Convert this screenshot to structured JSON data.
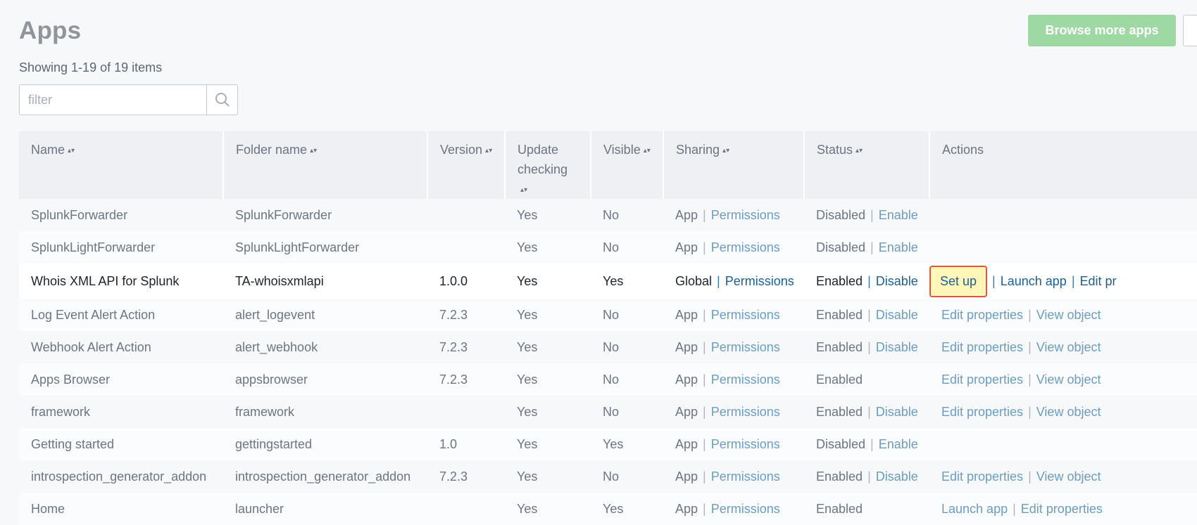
{
  "page": {
    "title": "Apps",
    "browse_more_label": "Browse more apps",
    "showing_text": "Showing 1-19 of 19 items"
  },
  "filter": {
    "placeholder": "filter",
    "value": ""
  },
  "table": {
    "columns": [
      "Name",
      "Folder name",
      "Version",
      "Update checking",
      "Visible",
      "Sharing",
      "Status",
      "Actions"
    ],
    "rows": [
      {
        "name": "SplunkForwarder",
        "folder": "SplunkForwarder",
        "version": "",
        "update": "Yes",
        "visible": "No",
        "sharing": "App",
        "sharing_link": "Permissions",
        "status": "Disabled",
        "status_link": "Enable",
        "actions": []
      },
      {
        "name": "SplunkLightForwarder",
        "folder": "SplunkLightForwarder",
        "version": "",
        "update": "Yes",
        "visible": "No",
        "sharing": "App",
        "sharing_link": "Permissions",
        "status": "Disabled",
        "status_link": "Enable",
        "actions": []
      },
      {
        "name": "Whois XML API for Splunk",
        "folder": "TA-whoisxmlapi",
        "version": "1.0.0",
        "update": "Yes",
        "visible": "Yes",
        "sharing": "Global",
        "sharing_link": "Permissions",
        "status": "Enabled",
        "status_link": "Disable",
        "actions": [
          "Set up",
          "Launch app",
          "Edit pr"
        ],
        "active": true
      },
      {
        "name": "Log Event Alert Action",
        "folder": "alert_logevent",
        "version": "7.2.3",
        "update": "Yes",
        "visible": "No",
        "sharing": "App",
        "sharing_link": "Permissions",
        "status": "Enabled",
        "status_link": "Disable",
        "actions": [
          "Edit properties",
          "View object"
        ]
      },
      {
        "name": "Webhook Alert Action",
        "folder": "alert_webhook",
        "version": "7.2.3",
        "update": "Yes",
        "visible": "No",
        "sharing": "App",
        "sharing_link": "Permissions",
        "status": "Enabled",
        "status_link": "Disable",
        "actions": [
          "Edit properties",
          "View object"
        ]
      },
      {
        "name": "Apps Browser",
        "folder": "appsbrowser",
        "version": "7.2.3",
        "update": "Yes",
        "visible": "No",
        "sharing": "App",
        "sharing_link": "Permissions",
        "status": "Enabled",
        "status_link": "",
        "actions": [
          "Edit properties",
          "View object"
        ]
      },
      {
        "name": "framework",
        "folder": "framework",
        "version": "",
        "update": "Yes",
        "visible": "No",
        "sharing": "App",
        "sharing_link": "Permissions",
        "status": "Enabled",
        "status_link": "Disable",
        "actions": [
          "Edit properties",
          "View object"
        ]
      },
      {
        "name": "Getting started",
        "folder": "gettingstarted",
        "version": "1.0",
        "update": "Yes",
        "visible": "Yes",
        "sharing": "App",
        "sharing_link": "Permissions",
        "status": "Disabled",
        "status_link": "Enable",
        "actions": []
      },
      {
        "name": "introspection_generator_addon",
        "folder": "introspection_generator_addon",
        "version": "7.2.3",
        "update": "Yes",
        "visible": "No",
        "sharing": "App",
        "sharing_link": "Permissions",
        "status": "Enabled",
        "status_link": "Disable",
        "actions": [
          "Edit properties",
          "View object"
        ]
      },
      {
        "name": "Home",
        "folder": "launcher",
        "version": "",
        "update": "Yes",
        "visible": "Yes",
        "sharing": "App",
        "sharing_link": "Permissions",
        "status": "Enabled",
        "status_link": "",
        "actions": [
          "Launch app",
          "Edit properties"
        ]
      }
    ]
  },
  "icons": {
    "search": "search-icon",
    "sort": "sort-icon"
  },
  "colors": {
    "accent_green": "#9ed8a3",
    "link": "#6a9dc6",
    "link_active": "#1a5f99",
    "highlight": "#fff6b8",
    "highlight_border": "#e2553c"
  }
}
